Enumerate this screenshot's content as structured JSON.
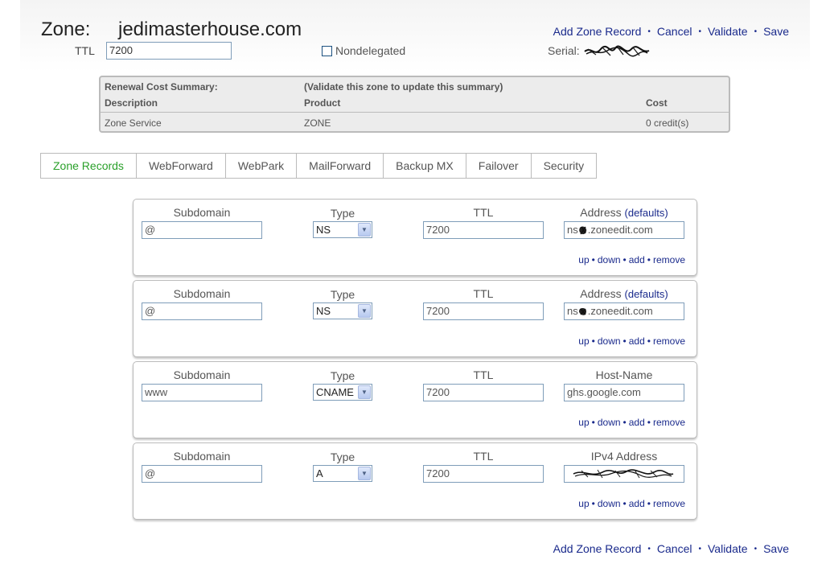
{
  "header": {
    "zone_label": "Zone:",
    "zone_name": "jedimasterhouse.com",
    "ttl_label": "TTL",
    "ttl_value": "7200",
    "nondelegated_label": "Nondelegated",
    "serial_label": "Serial:"
  },
  "actions": {
    "add_zone_record": "Add Zone Record",
    "cancel": "Cancel",
    "validate": "Validate",
    "save": "Save",
    "separator": "•"
  },
  "summary": {
    "title": "Renewal Cost Summary:",
    "note": "(Validate this zone to update this summary)",
    "col_description": "Description",
    "col_product": "Product",
    "col_cost": "Cost",
    "rows": [
      {
        "description": "Zone Service",
        "product": "ZONE",
        "cost": "0 credit(s)"
      }
    ]
  },
  "tabs": [
    {
      "label": "Zone Records",
      "active": true
    },
    {
      "label": "WebForward"
    },
    {
      "label": "WebPark"
    },
    {
      "label": "MailForward"
    },
    {
      "label": "Backup MX"
    },
    {
      "label": "Failover"
    },
    {
      "label": "Security"
    }
  ],
  "records": [
    {
      "subdomain_label": "Subdomain",
      "type_label": "Type",
      "ttl_label": "TTL",
      "address_label": "Address",
      "defaults_label": "(defaults)",
      "subdomain": "@",
      "type": "NS",
      "ttl": "7200",
      "address_prefix": "ns",
      "address_suffix": ".zoneedit.com"
    },
    {
      "subdomain_label": "Subdomain",
      "type_label": "Type",
      "ttl_label": "TTL",
      "address_label": "Address",
      "defaults_label": "(defaults)",
      "subdomain": "@",
      "type": "NS",
      "ttl": "7200",
      "address_prefix": "ns",
      "address_suffix": ".zoneedit.com"
    },
    {
      "subdomain_label": "Subdomain",
      "type_label": "Type",
      "ttl_label": "TTL",
      "address_label": "Host-Name",
      "subdomain": "www",
      "type": "CNAME",
      "ttl": "7200",
      "address": "ghs.google.com"
    },
    {
      "subdomain_label": "Subdomain",
      "type_label": "Type",
      "ttl_label": "TTL",
      "address_label": "IPv4 Address",
      "subdomain": "@",
      "type": "A",
      "ttl": "7200",
      "address": ""
    }
  ],
  "record_ops": {
    "up": "up",
    "down": "down",
    "add": "add",
    "remove": "remove",
    "separator": "•"
  },
  "colors": {
    "link": "#1a2a8c",
    "active_tab": "#2aa02a",
    "summary_bg": "#ececec"
  }
}
